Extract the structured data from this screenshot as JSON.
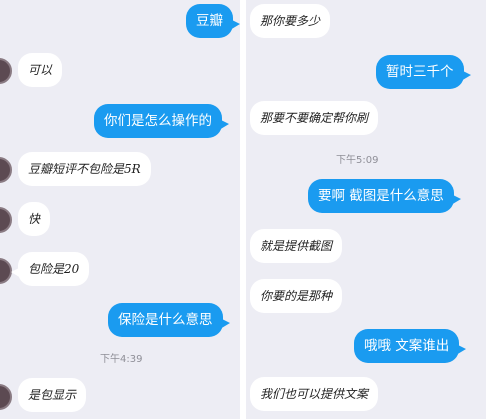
{
  "left": {
    "messages": [
      {
        "side": "out",
        "text": "豆瓣"
      },
      {
        "side": "in",
        "text": "可以"
      },
      {
        "side": "out",
        "text": "你们是怎么操作的"
      },
      {
        "side": "in",
        "text": "豆瓣短评不包险是5Ɍ"
      },
      {
        "side": "in",
        "text": "快"
      },
      {
        "side": "in",
        "text": "包险是20"
      },
      {
        "side": "out",
        "text": "保险是什么意思"
      },
      {
        "side": "in",
        "text": "是包显示"
      }
    ],
    "timestamp": "下午4:39"
  },
  "right": {
    "messages": [
      {
        "side": "in",
        "text": "那你要多少"
      },
      {
        "side": "out",
        "text": "暂时三千个"
      },
      {
        "side": "in",
        "text": "那要不要确定帮你刷"
      },
      {
        "side": "out",
        "text": "要啊 截图是什么意思"
      },
      {
        "side": "in",
        "text": "就是提供截图"
      },
      {
        "side": "in",
        "text": "你要的是那种"
      },
      {
        "side": "out",
        "text": "哦哦 文案谁出"
      },
      {
        "side": "in",
        "text": "我们也可以提供文案"
      }
    ],
    "timestamp": "下午5:09"
  },
  "colors": {
    "panel_bg": "#ededf4",
    "outgoing_bubble": "#1a9bf0",
    "incoming_bubble": "#ffffff",
    "timestamp_text": "#8f8f97"
  }
}
